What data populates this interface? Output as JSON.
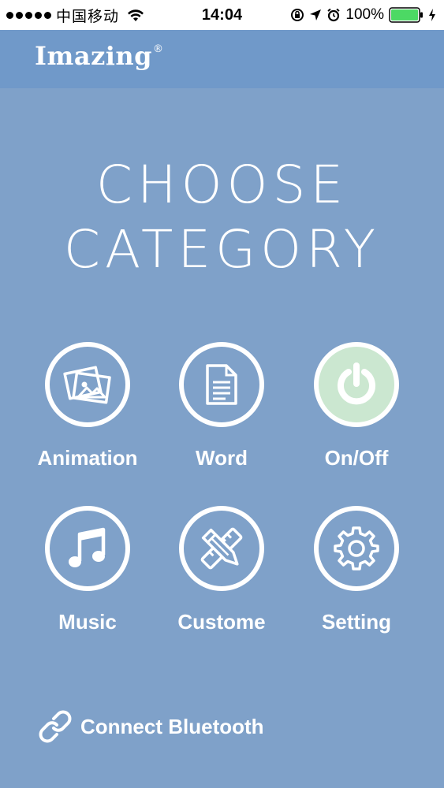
{
  "status_bar": {
    "carrier": "中国移动",
    "time": "14:04",
    "battery": "100%",
    "icons": [
      "signal-dots-icon",
      "wifi-icon",
      "rotation-lock-icon",
      "location-arrow-icon",
      "alarm-icon",
      "battery-icon",
      "charging-bolt-icon"
    ],
    "battery_color": "#4cd964"
  },
  "header": {
    "logo": "Imazing",
    "logo_mark": "®",
    "color": "#7099c9"
  },
  "title": {
    "line1": "CHOOSE",
    "line2": "CATEGORY"
  },
  "categories": [
    {
      "label": "Animation",
      "icon": "pictures-icon"
    },
    {
      "label": "Word",
      "icon": "document-icon"
    },
    {
      "label": "On/Off",
      "icon": "power-icon",
      "active": true
    },
    {
      "label": "Music",
      "icon": "music-note-icon"
    },
    {
      "label": "Custome",
      "icon": "pencil-ruler-icon"
    },
    {
      "label": "Setting",
      "icon": "gear-icon"
    }
  ],
  "footer": {
    "bluetooth_label": "Connect Bluetooth",
    "icon": "link-icon"
  },
  "colors": {
    "background": "#7fa1c9",
    "active_circle": "#cbe7d0"
  }
}
